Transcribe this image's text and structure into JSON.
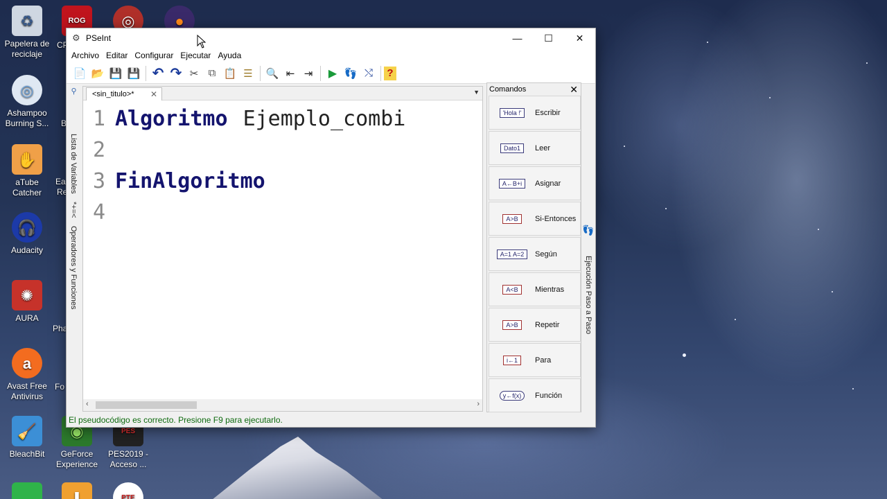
{
  "desktop": {
    "icons_left": [
      {
        "label": "Papelera de reciclaje",
        "icon": "recycle-bin-icon"
      },
      {
        "label": "Ashampoo Burning S...",
        "icon": "disc-icon"
      },
      {
        "label": "aTube Catcher",
        "icon": "catcher-icon"
      },
      {
        "label": "Audacity",
        "icon": "headphones-icon"
      },
      {
        "label": "AURA",
        "icon": "aura-icon"
      },
      {
        "label": "Avast Free Antivirus",
        "icon": "avast-icon"
      },
      {
        "label": "BleachBit",
        "icon": "broom-icon"
      }
    ],
    "icons_second": [
      {
        "label": "GeForce Experience",
        "icon": "nvidia-icon"
      },
      {
        "label": "PES2019 - Acceso ...",
        "icon": "game-icon"
      }
    ],
    "partial_labels": [
      "CP",
      "B",
      "Ea",
      "Re",
      "Pha",
      "Fo"
    ]
  },
  "window": {
    "title": "PSeInt",
    "controls": {
      "minimize": "—",
      "maximize": "☐",
      "close": "✕"
    },
    "menu": [
      "Archivo",
      "Editar",
      "Configurar",
      "Ejecutar",
      "Ayuda"
    ],
    "toolbar": [
      {
        "name": "new-file-icon",
        "glyph": "📄"
      },
      {
        "name": "open-folder-icon",
        "glyph": "📂"
      },
      {
        "name": "save-icon",
        "glyph": "💾"
      },
      {
        "name": "save-as-icon",
        "glyph": "💾"
      },
      {
        "name": "undo-icon",
        "glyph": "↶"
      },
      {
        "name": "redo-icon",
        "glyph": "↷"
      },
      {
        "name": "cut-icon",
        "glyph": "✂"
      },
      {
        "name": "copy-icon",
        "glyph": "⧉"
      },
      {
        "name": "paste-icon",
        "glyph": "📋"
      },
      {
        "name": "indent-icon",
        "glyph": "☰"
      },
      {
        "name": "find-icon",
        "glyph": "🔍"
      },
      {
        "name": "find-prev-icon",
        "glyph": "⇤"
      },
      {
        "name": "find-next-icon",
        "glyph": "⇥"
      },
      {
        "name": "run-icon",
        "glyph": "▶"
      },
      {
        "name": "step-by-step-icon",
        "glyph": "👣"
      },
      {
        "name": "flowchart-icon",
        "glyph": "⤭"
      },
      {
        "name": "help-icon",
        "glyph": "?"
      }
    ],
    "left_tabs": {
      "variables": "Lista de Variables",
      "operators": "Operadores y Funciones"
    },
    "editor": {
      "tab_label": "<sin_titulo>*",
      "lines": [
        {
          "n": "1",
          "kw": "Algoritmo",
          "id": "Ejemplo_combi"
        },
        {
          "n": "2",
          "kw": "",
          "id": ""
        },
        {
          "n": "3",
          "kw": "FinAlgoritmo",
          "id": ""
        },
        {
          "n": "4",
          "kw": "",
          "id": ""
        }
      ]
    },
    "commands": {
      "title": "Comandos",
      "items": [
        {
          "label": "Escribir",
          "symbol": "'Hola !'"
        },
        {
          "label": "Leer",
          "symbol": "Dato1"
        },
        {
          "label": "Asignar",
          "symbol": "A←B+i"
        },
        {
          "label": "Si-Entonces",
          "symbol": "A>B"
        },
        {
          "label": "Según",
          "symbol": "A=1 A=2"
        },
        {
          "label": "Mientras",
          "symbol": "A<B"
        },
        {
          "label": "Repetir",
          "symbol": "A>B"
        },
        {
          "label": "Para",
          "symbol": "i←1"
        },
        {
          "label": "Función",
          "symbol": "y←f(x)"
        }
      ]
    },
    "right_tab": "Ejecución Paso a Paso",
    "status": "El pseudocódigo es correcto. Presione F9 para ejecutarlo."
  }
}
